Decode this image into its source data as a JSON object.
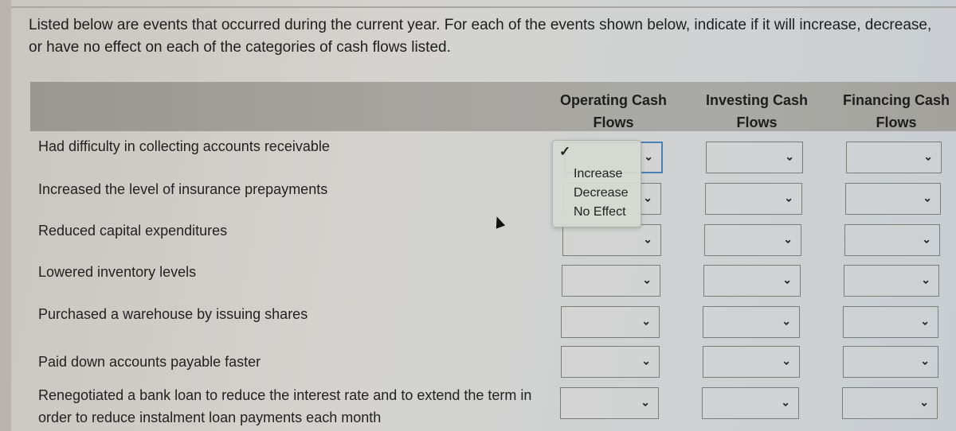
{
  "instructions": "Listed below are events that occurred during the current year. For each of the events shown below, indicate if it will increase, decrease, or have no effect on each of the categories of cash flows listed.",
  "columns": {
    "operating": "Operating Cash Flows",
    "investing": "Investing Cash Flows",
    "financing": "Financing Cash Flows"
  },
  "events": [
    {
      "label": "Had difficulty in collecting accounts receivable",
      "operating": "",
      "investing": "",
      "financing": ""
    },
    {
      "label": "Increased the level of insurance prepayments",
      "operating": "",
      "investing": "",
      "financing": ""
    },
    {
      "label": "Reduced capital expenditures",
      "operating": "",
      "investing": "",
      "financing": ""
    },
    {
      "label": "Lowered inventory levels",
      "operating": "",
      "investing": "",
      "financing": ""
    },
    {
      "label": "Purchased a warehouse by issuing shares",
      "operating": "",
      "investing": "",
      "financing": ""
    },
    {
      "label": "Paid down accounts payable faster",
      "operating": "",
      "investing": "",
      "financing": ""
    },
    {
      "label": "Renegotiated a bank loan to reduce the interest rate and to extend the term in order to reduce instalment loan payments each month",
      "operating": "",
      "investing": "",
      "financing": ""
    }
  ],
  "dropdown": {
    "open_for": "Had difficulty in collecting accounts receivable - Operating Cash Flows",
    "selected": "",
    "check_icon": "✓",
    "options": [
      "Increase",
      "Decrease",
      "No Effect"
    ]
  },
  "icons": {
    "chevron": "⌄"
  }
}
